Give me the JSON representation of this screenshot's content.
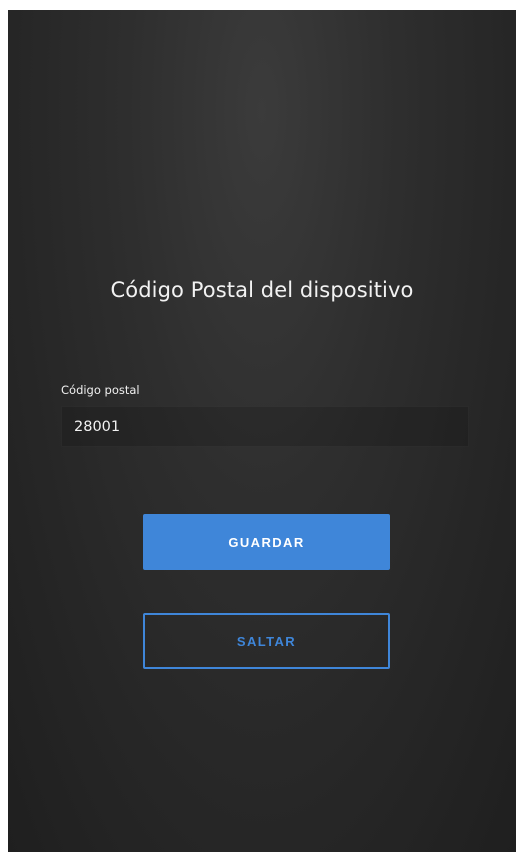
{
  "page": {
    "title": "Código Postal del dispositivo"
  },
  "postal_code": {
    "label": "Código postal",
    "value": "28001"
  },
  "buttons": {
    "save_label": "GUARDAR",
    "skip_label": "SALTAR"
  },
  "colors": {
    "accent": "#3f86d9",
    "background": "#2a2a2a",
    "text": "#f2f2f2"
  }
}
